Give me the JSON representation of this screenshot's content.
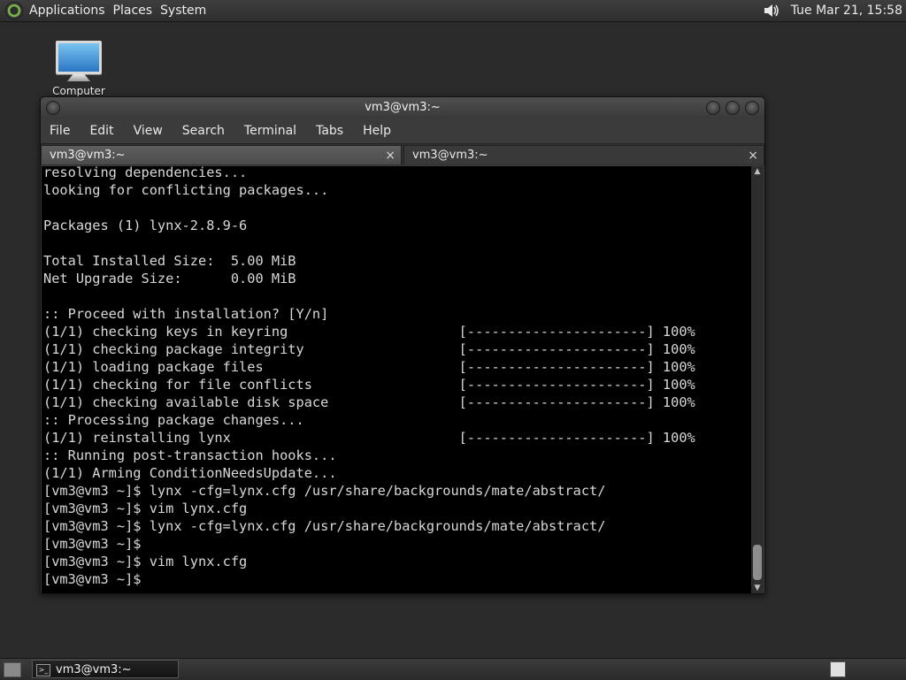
{
  "top_panel": {
    "menus": [
      "Applications",
      "Places",
      "System"
    ],
    "clock": "Tue Mar 21, 15:58"
  },
  "desktop": {
    "icon_label": "Computer"
  },
  "window": {
    "title": "vm3@vm3:~",
    "menu": [
      "File",
      "Edit",
      "View",
      "Search",
      "Terminal",
      "Tabs",
      "Help"
    ],
    "tabs": [
      {
        "label": "vm3@vm3:~",
        "close": "×"
      },
      {
        "label": "vm3@vm3:~",
        "close": "×"
      }
    ],
    "terminal_lines": [
      "resolving dependencies...",
      "looking for conflicting packages...",
      "",
      "Packages (1) lynx-2.8.9-6",
      "",
      "Total Installed Size:  5.00 MiB",
      "Net Upgrade Size:      0.00 MiB",
      "",
      ":: Proceed with installation? [Y/n]",
      "(1/1) checking keys in keyring                     [----------------------] 100%",
      "(1/1) checking package integrity                   [----------------------] 100%",
      "(1/1) loading package files                        [----------------------] 100%",
      "(1/1) checking for file conflicts                  [----------------------] 100%",
      "(1/1) checking available disk space                [----------------------] 100%",
      ":: Processing package changes...",
      "(1/1) reinstalling lynx                            [----------------------] 100%",
      ":: Running post-transaction hooks...",
      "(1/1) Arming ConditionNeedsUpdate...",
      "[vm3@vm3 ~]$ lynx -cfg=lynx.cfg /usr/share/backgrounds/mate/abstract/",
      "[vm3@vm3 ~]$ vim lynx.cfg",
      "[vm3@vm3 ~]$ lynx -cfg=lynx.cfg /usr/share/backgrounds/mate/abstract/",
      "[vm3@vm3 ~]$",
      "[vm3@vm3 ~]$ vim lynx.cfg",
      "[vm3@vm3 ~]$"
    ]
  },
  "bottom_panel": {
    "task_label": "vm3@vm3:~"
  }
}
